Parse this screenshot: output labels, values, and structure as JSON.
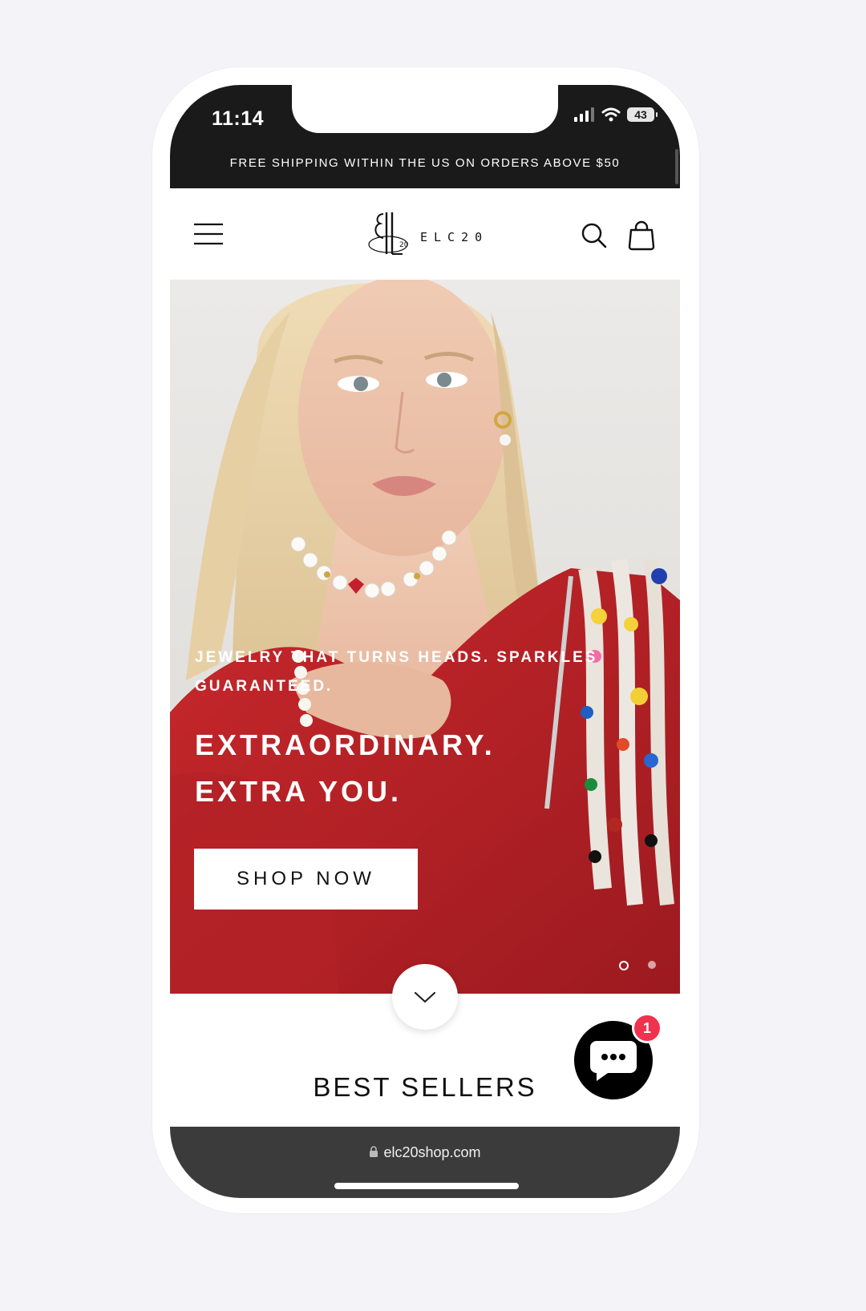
{
  "status_bar": {
    "time": "11:14",
    "battery": "43"
  },
  "announcement": {
    "text": "FREE SHIPPING WITHIN THE US ON ORDERS ABOVE $50"
  },
  "header": {
    "logo_text": "ELC20",
    "logo_mark": "20"
  },
  "hero": {
    "eyebrow": "JEWELRY THAT TURNS HEADS. SPARKLES GUARANTEED.",
    "heading_line1": "EXTRAORDINARY.",
    "heading_line2": "EXTRA YOU.",
    "cta_label": "SHOP NOW",
    "slide_count": 2,
    "active_slide": 1
  },
  "section": {
    "title": "BEST SELLERS"
  },
  "chat": {
    "badge_count": "1"
  },
  "browser": {
    "url": "elc20shop.com"
  },
  "icons": {
    "menu": "hamburger-menu-icon",
    "search": "search-icon",
    "cart": "shopping-bag-icon",
    "scroll": "chevron-down-icon",
    "chat": "chat-bubble-icon",
    "lock": "lock-icon"
  },
  "colors": {
    "dark_bar": "#1a1a1a",
    "hero_red": "#b8262a",
    "badge": "#f0324e",
    "url_bar": "#3b3b3b"
  }
}
